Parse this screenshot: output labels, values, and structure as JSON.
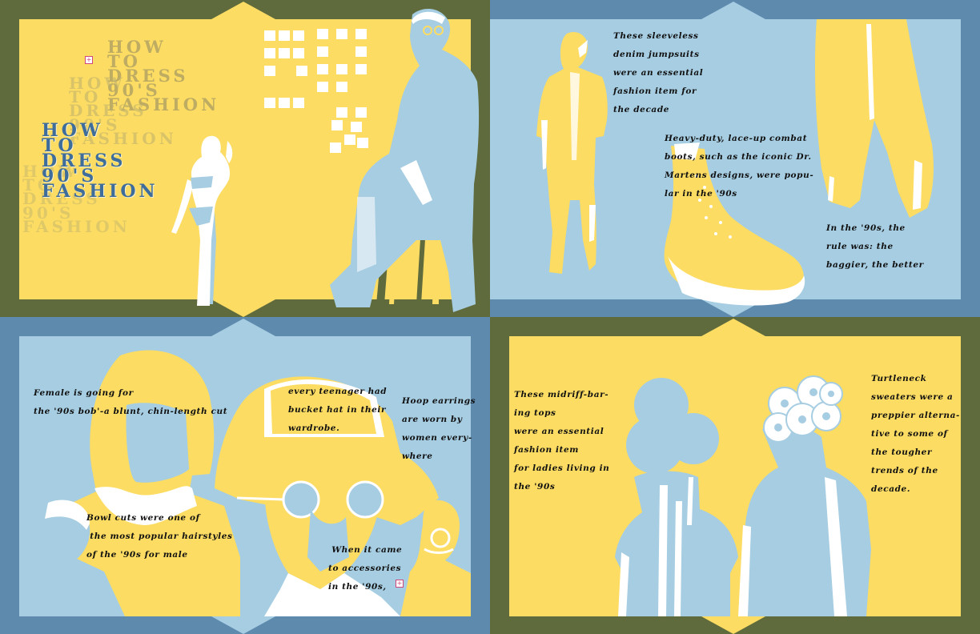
{
  "colors": {
    "olive": "#5f6b3c",
    "steel_blue": "#5e8aae",
    "light_blue": "#a6cde2",
    "yellow": "#fcdc62",
    "white": "#ffffff",
    "title_blue": "#3e6c9b"
  },
  "panel1": {
    "title_lines": [
      "HOW",
      "TO",
      "DRESS",
      "90'S",
      "FASHION"
    ],
    "marker_icon": "plus-box-icon"
  },
  "panel2": {
    "jumpsuit_caption": [
      "These sleeveless",
      "denim jumpsuits",
      "were an essential",
      "fashion item for",
      "the decade"
    ],
    "boots_caption": [
      "Heavy-duty, lace-up combat",
      "boots, such as the iconic Dr.",
      "Martens designs, were popu-",
      "lar in the '90s"
    ],
    "baggy_caption": [
      "In the '90s, the",
      "rule was: the",
      "baggier, the better"
    ]
  },
  "panel3": {
    "bob_caption": [
      "Female is going for",
      "the '90s bob'-a blunt, chin-length cut"
    ],
    "bucket_caption": [
      "every teenager had",
      "bucket hat in their",
      "wardrobe."
    ],
    "hoop_caption": [
      "Hoop earrings",
      "are worn by",
      "women every-",
      "where"
    ],
    "bowl_caption": [
      "Bowl cuts were one of",
      " the most popular hairstyles",
      "of the '90s for male"
    ],
    "accessories_caption": [
      " When it came",
      "to accessories",
      "in the '90s,"
    ],
    "marker_icon": "plus-box-icon"
  },
  "panel4": {
    "midriff_caption": [
      "These midriff-bar-",
      "ing tops",
      "were an essential",
      "fashion item",
      "for ladies living in",
      "the '90s"
    ],
    "turtleneck_caption": [
      "Turtleneck",
      "sweaters were a",
      "preppier alterna-",
      "tive to some of",
      "the tougher",
      "trends of the",
      "decade."
    ]
  }
}
